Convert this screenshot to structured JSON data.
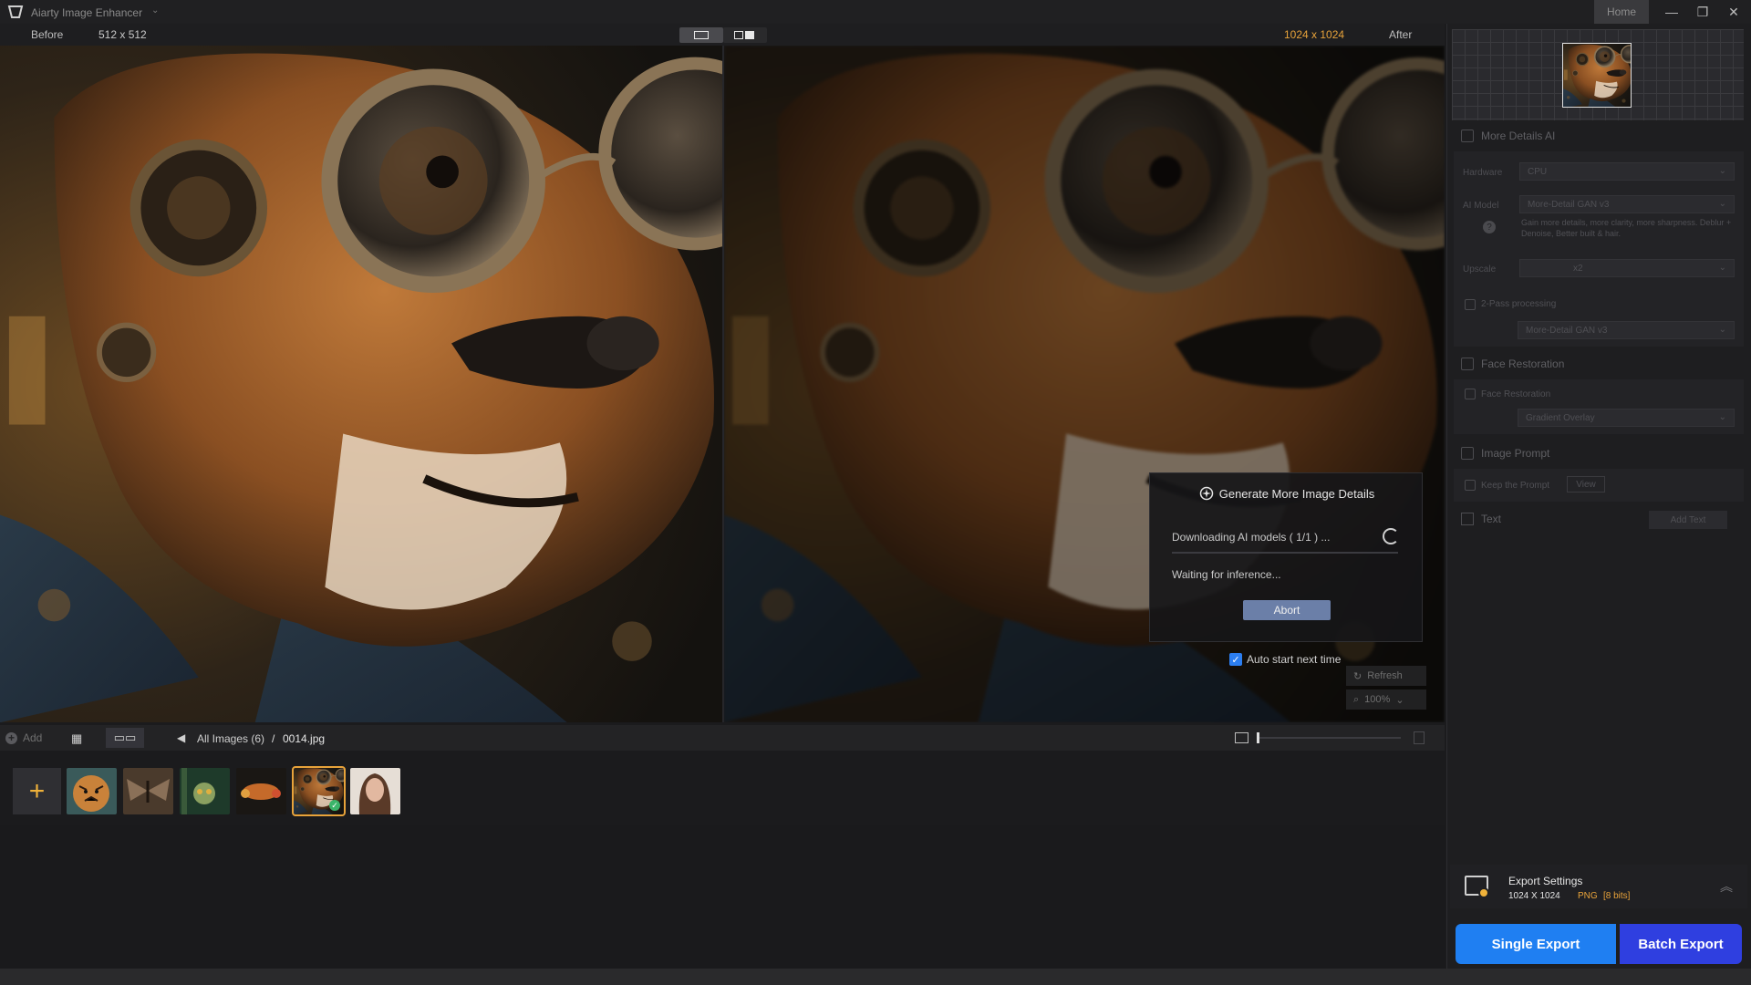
{
  "window": {
    "title": "Aiarty Image Enhancer",
    "home_label": "Home",
    "minimize": "—",
    "restore": "❐",
    "close": "✕"
  },
  "viewer": {
    "before_label": "Before",
    "before_size": "512 x 512",
    "after_size": "1024 x 1024",
    "after_label": "After"
  },
  "dialog": {
    "title": "Generate More Image Details",
    "status": "Downloading AI models ( 1/1 ) ...",
    "progress": 0.0,
    "waiting": "Waiting for inference...",
    "abort_label": "Abort",
    "auto_start_label": "Auto start next time",
    "auto_start_checked": true
  },
  "overlay_tools": {
    "refresh_label": "Refresh",
    "zoom_label": "100%"
  },
  "gallery": {
    "add_label": "Add",
    "breadcrumb_all": "All Images (6)",
    "breadcrumb_sep": "/",
    "breadcrumb_file": "0014.jpg",
    "thumbnail_slider": 0.0,
    "thumbnails": [
      {
        "name": "tiger",
        "selected": false
      },
      {
        "name": "moth",
        "selected": false
      },
      {
        "name": "forest-creature",
        "selected": false
      },
      {
        "name": "fox-flowers",
        "selected": false
      },
      {
        "name": "steampunk-dog",
        "selected": true
      },
      {
        "name": "woman-portrait",
        "selected": false
      }
    ]
  },
  "sidebar": {
    "more_details": {
      "title": "More Details AI",
      "hardware_label": "Hardware",
      "hardware_value": "CPU",
      "ai_model_label": "AI Model",
      "ai_model_value": "More-Detail GAN  v3",
      "ai_model_desc": "Gain more details, more clarity, more sharpness. Deblur + Denoise, Better built & hair.",
      "upscale_label": "Upscale",
      "upscale_value": "x2",
      "two_pass_label": "2-Pass processing",
      "two_pass_value": "More-Detail GAN  v3"
    },
    "face_restoration": {
      "title": "Face Restoration",
      "toggle_label": "Face Restoration",
      "mode_value": "Gradient Overlay"
    },
    "image_prompt": {
      "title": "Image Prompt",
      "keep_label": "Keep the Prompt",
      "view_label": "View"
    },
    "text": {
      "title": "Text",
      "add_text_label": "Add Text"
    },
    "export": {
      "title": "Export Settings",
      "dims": "1024 X 1024",
      "format": "PNG",
      "bits": "[8 bits]",
      "single_label": "Single Export",
      "batch_label": "Batch Export"
    }
  },
  "colors": {
    "accent": "#e8a33a",
    "primary_button": "#1f7ff2",
    "batch_button": "#2f3fe0"
  }
}
